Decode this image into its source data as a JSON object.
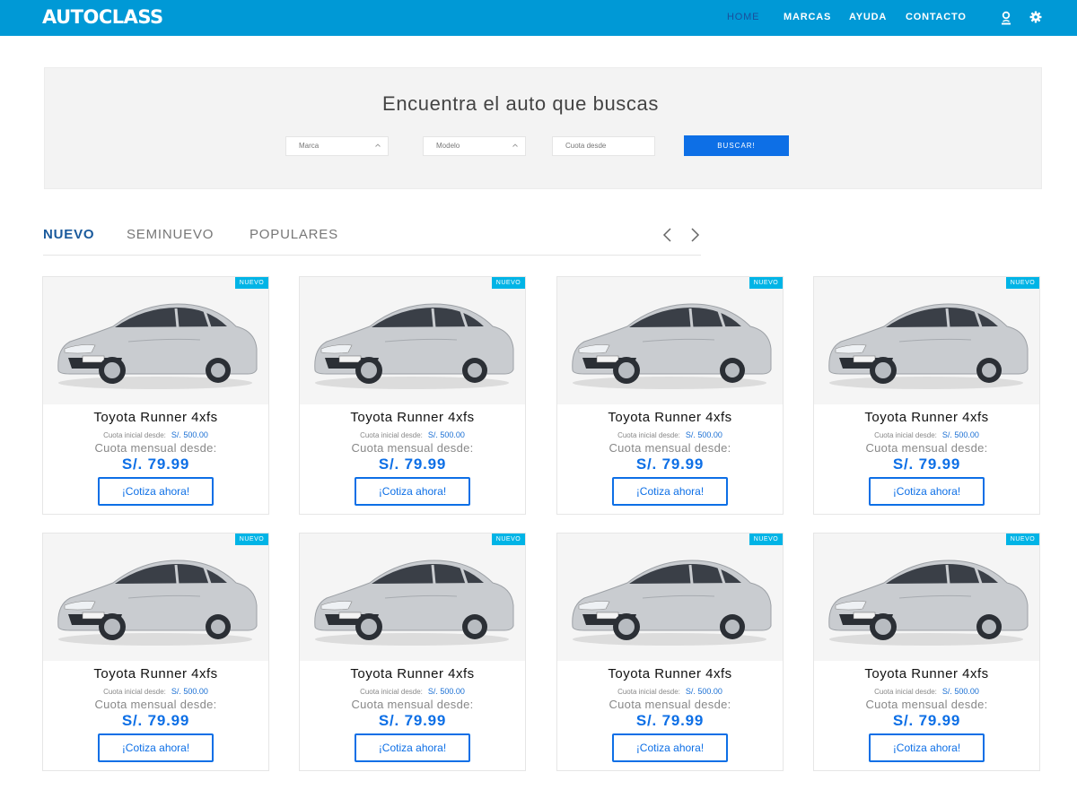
{
  "header": {
    "logo": "AUTOCLASS",
    "nav": [
      "HOME",
      "MARCAS",
      "AYUDA",
      "CONTACTO"
    ]
  },
  "search": {
    "title": "Encuentra el auto que buscas",
    "marca_label": "Marca",
    "modelo_label": "Modelo",
    "cuota_placeholder": "Cuota desde",
    "button": "BUSCAR!"
  },
  "tabs": [
    "NUEVO",
    "SEMINUEVO",
    "POPULARES"
  ],
  "cards": [
    {
      "badge": "NUEVO",
      "title": "Toyota Runner 4xfs",
      "cuota_inicial_label": "Cuota inicial desde:",
      "cuota_inicial": "S/. 500.00",
      "cuota_mensual_label": "Cuota mensual desde:",
      "price": "S/. 79.99",
      "cta": "¡Cotiza ahora!"
    },
    {
      "badge": "NUEVO",
      "title": "Toyota Runner 4xfs",
      "cuota_inicial_label": "Cuota inicial desde:",
      "cuota_inicial": "S/. 500.00",
      "cuota_mensual_label": "Cuota mensual desde:",
      "price": "S/. 79.99",
      "cta": "¡Cotiza ahora!"
    },
    {
      "badge": "NUEVO",
      "title": "Toyota Runner 4xfs",
      "cuota_inicial_label": "Cuota inicial desde:",
      "cuota_inicial": "S/. 500.00",
      "cuota_mensual_label": "Cuota mensual desde:",
      "price": "S/. 79.99",
      "cta": "¡Cotiza ahora!"
    },
    {
      "badge": "NUEVO",
      "title": "Toyota Runner 4xfs",
      "cuota_inicial_label": "Cuota inicial desde:",
      "cuota_inicial": "S/. 500.00",
      "cuota_mensual_label": "Cuota mensual desde:",
      "price": "S/. 79.99",
      "cta": "¡Cotiza ahora!"
    },
    {
      "badge": "NUEVO",
      "title": "Toyota Runner 4xfs",
      "cuota_inicial_label": "Cuota inicial desde:",
      "cuota_inicial": "S/. 500.00",
      "cuota_mensual_label": "Cuota mensual desde:",
      "price": "S/. 79.99",
      "cta": "¡Cotiza ahora!"
    },
    {
      "badge": "NUEVO",
      "title": "Toyota Runner 4xfs",
      "cuota_inicial_label": "Cuota inicial desde:",
      "cuota_inicial": "S/. 500.00",
      "cuota_mensual_label": "Cuota mensual desde:",
      "price": "S/. 79.99",
      "cta": "¡Cotiza ahora!"
    },
    {
      "badge": "NUEVO",
      "title": "Toyota Runner 4xfs",
      "cuota_inicial_label": "Cuota inicial desde:",
      "cuota_inicial": "S/. 500.00",
      "cuota_mensual_label": "Cuota mensual desde:",
      "price": "S/. 79.99",
      "cta": "¡Cotiza ahora!"
    },
    {
      "badge": "NUEVO",
      "title": "Toyota Runner 4xfs",
      "cuota_inicial_label": "Cuota inicial desde:",
      "cuota_inicial": "S/. 500.00",
      "cuota_mensual_label": "Cuota mensual desde:",
      "price": "S/. 79.99",
      "cta": "¡Cotiza ahora!"
    }
  ],
  "icons": {
    "user": "user-icon",
    "settings": "gear-icon",
    "prev": "chevron-left-icon",
    "next": "chevron-right-icon",
    "car": "car-image"
  },
  "colors": {
    "navbar": "#0099d6",
    "primary": "#0d6fe6",
    "badge": "#00b4e6",
    "active_tab": "#1a5a9c"
  }
}
